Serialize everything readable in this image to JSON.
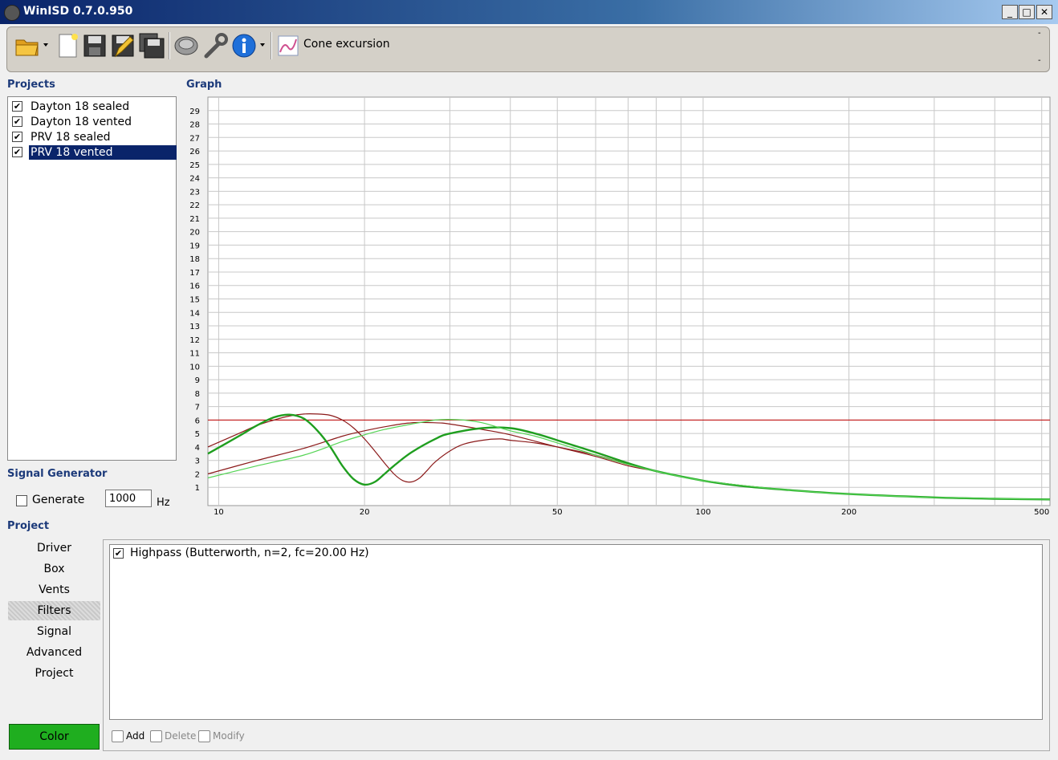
{
  "window": {
    "title": "WinISD 0.7.0.950",
    "min": "_",
    "max": "□",
    "close": "✕"
  },
  "toolbar": {
    "cone_label": "Cone excursion",
    "dash1": "-",
    "dash2": "-"
  },
  "projects": {
    "label": "Projects",
    "items": [
      {
        "label": "Dayton 18 sealed",
        "checked": "✔"
      },
      {
        "label": "Dayton 18 vented",
        "checked": "✔"
      },
      {
        "label": "PRV 18 sealed",
        "checked": "✔"
      },
      {
        "label": "PRV 18 vented",
        "checked": "✔",
        "selected": true
      }
    ]
  },
  "signal_generator": {
    "label": "Signal Generator",
    "generate_label": "Generate",
    "frequency": "1000",
    "unit": "Hz"
  },
  "graph": {
    "label": "Graph"
  },
  "chart_data": {
    "type": "line",
    "x_scale": "log",
    "xlim": [
      9.5,
      520
    ],
    "ylim": [
      0,
      30
    ],
    "x_ticks": [
      10,
      20,
      50,
      100,
      200,
      500
    ],
    "y_ticks": [
      1,
      2,
      3,
      4,
      5,
      6,
      7,
      8,
      9,
      10,
      11,
      12,
      13,
      14,
      15,
      16,
      17,
      18,
      19,
      20,
      21,
      22,
      23,
      24,
      25,
      26,
      27,
      28,
      29
    ],
    "grid": true,
    "limit_line": {
      "y": 6,
      "color": "#c00000"
    },
    "series": [
      {
        "color": "#8b1a1a",
        "width": 1.2,
        "x": [
          9.5,
          11,
          12,
          13,
          14,
          15,
          16,
          17,
          18,
          19,
          20,
          21,
          22,
          23,
          24,
          25,
          26,
          27,
          28,
          30,
          32,
          35,
          38,
          40,
          45,
          50,
          60,
          70,
          80,
          100,
          120,
          150,
          200,
          300,
          400,
          520
        ],
        "y": [
          4.0,
          5.0,
          5.6,
          6.0,
          6.3,
          6.45,
          6.45,
          6.35,
          6.0,
          5.4,
          4.6,
          3.7,
          2.8,
          2.0,
          1.5,
          1.4,
          1.7,
          2.3,
          2.9,
          3.7,
          4.2,
          4.5,
          4.6,
          4.5,
          4.3,
          4.0,
          3.4,
          2.7,
          2.2,
          1.5,
          1.1,
          0.8,
          0.5,
          0.25,
          0.15,
          0.1
        ]
      },
      {
        "color": "#8b1a1a",
        "width": 1.2,
        "x": [
          9.5,
          12,
          15,
          18,
          20,
          22,
          25,
          28,
          30,
          35,
          40,
          50,
          60,
          70,
          80,
          100,
          150,
          200,
          300,
          520
        ],
        "y": [
          2.0,
          3.0,
          3.9,
          4.8,
          5.2,
          5.5,
          5.8,
          5.8,
          5.7,
          5.3,
          4.9,
          4.0,
          3.3,
          2.6,
          2.2,
          1.5,
          0.8,
          0.5,
          0.25,
          0.1
        ]
      },
      {
        "color": "#1f9e1f",
        "width": 2.4,
        "x": [
          9.5,
          11,
          12,
          13,
          14,
          15,
          16,
          17,
          18,
          19,
          20,
          21,
          22,
          23,
          25,
          28,
          30,
          35,
          40,
          45,
          50,
          60,
          70,
          80,
          100,
          120,
          150,
          200,
          300,
          400,
          520
        ],
        "y": [
          3.5,
          4.8,
          5.6,
          6.2,
          6.4,
          6.1,
          5.2,
          4.0,
          2.6,
          1.6,
          1.2,
          1.4,
          2.0,
          2.6,
          3.6,
          4.6,
          5.0,
          5.4,
          5.4,
          5.0,
          4.5,
          3.6,
          2.8,
          2.2,
          1.5,
          1.1,
          0.8,
          0.5,
          0.25,
          0.15,
          0.1
        ]
      },
      {
        "color": "#55d455",
        "width": 1.2,
        "x": [
          9.5,
          12,
          15,
          18,
          20,
          22,
          25,
          28,
          30,
          32,
          35,
          40,
          45,
          50,
          60,
          70,
          80,
          100,
          150,
          200,
          300,
          520
        ],
        "y": [
          1.7,
          2.6,
          3.4,
          4.4,
          4.9,
          5.3,
          5.7,
          6.0,
          6.05,
          6.0,
          5.8,
          5.2,
          4.8,
          4.3,
          3.4,
          2.7,
          2.2,
          1.5,
          0.8,
          0.5,
          0.25,
          0.1
        ]
      }
    ]
  },
  "project_nav": {
    "label": "Project",
    "items": [
      "Driver",
      "Box",
      "Vents",
      "Filters",
      "Signal",
      "Advanced",
      "Project"
    ],
    "active": "Filters",
    "color_button": "Color",
    "color_value": "#1fae1f"
  },
  "filters": {
    "items": [
      {
        "label": "Highpass (Butterworth, n=2, fc=20.00 Hz)",
        "checked": "✔"
      }
    ],
    "add": "Add",
    "delete": "Delete",
    "modify": "Modify"
  }
}
